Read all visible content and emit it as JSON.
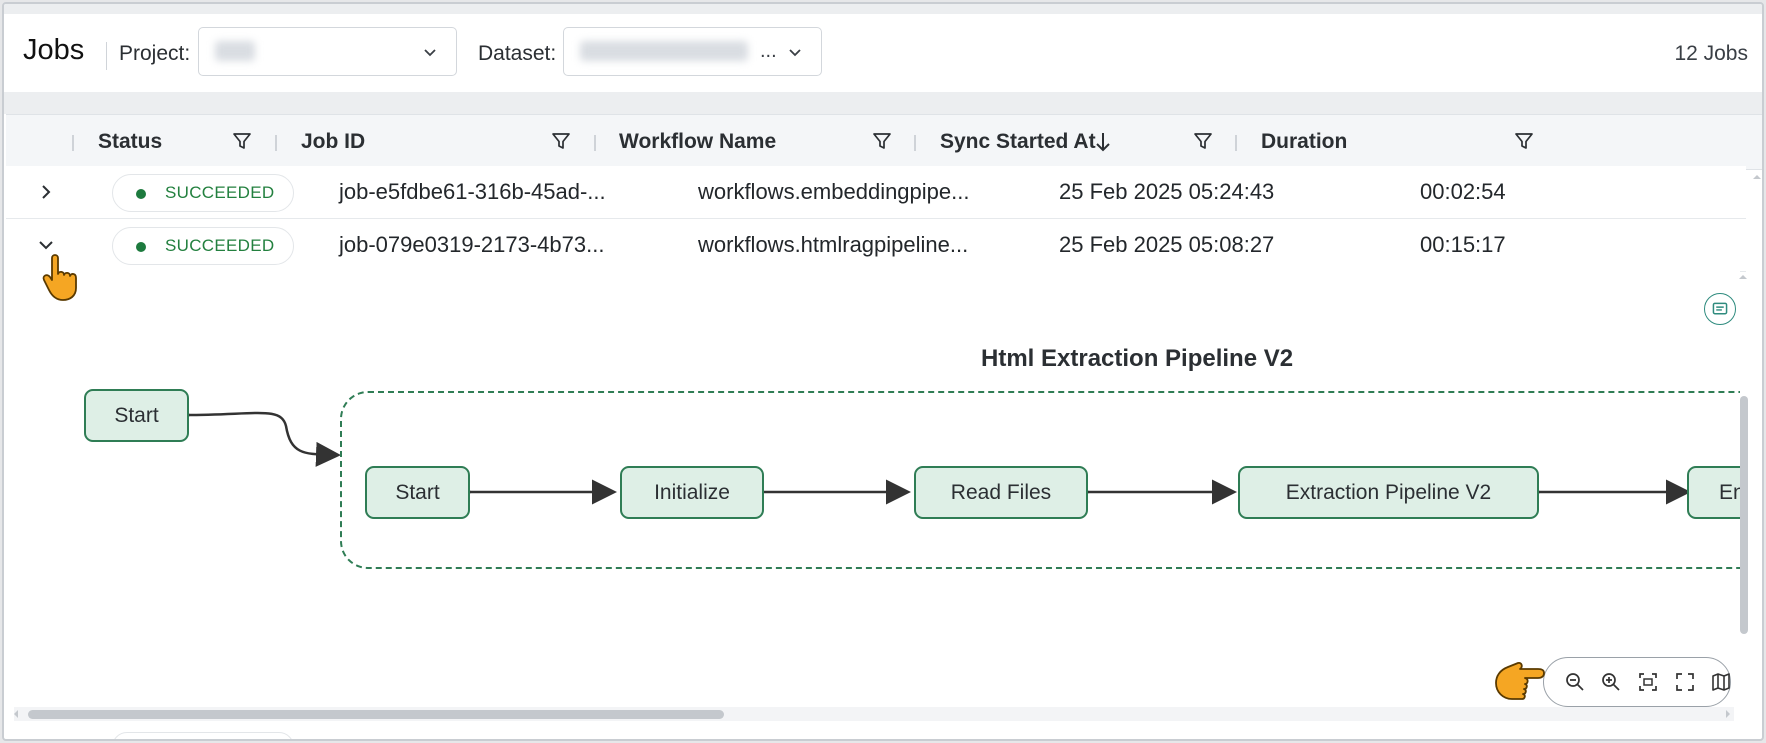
{
  "header": {
    "title": "Jobs",
    "project_label": "Project:",
    "dataset_label": "Dataset:",
    "dataset_value": "...",
    "jobs_count": "12 Jobs"
  },
  "table": {
    "columns": [
      {
        "label": "Status"
      },
      {
        "label": "Job ID"
      },
      {
        "label": "Workflow Name"
      },
      {
        "label": "Sync Started At"
      },
      {
        "label": "Duration"
      }
    ],
    "rows": [
      {
        "status": "SUCCEEDED",
        "job_id": "job-e5fdbe61-316b-45ad-...",
        "workflow": "workflows.embeddingpipe...",
        "started": "25 Feb 2025 05:24:43",
        "duration": "00:02:54",
        "expanded": false
      },
      {
        "status": "SUCCEEDED",
        "job_id": "job-079e0319-2173-4b73...",
        "workflow": "workflows.htmlragpipeline...",
        "started": "25 Feb 2025 05:08:27",
        "duration": "00:15:17",
        "expanded": true
      }
    ]
  },
  "workflow_graph": {
    "title": "Html Extraction Pipeline V2",
    "outer_start": "Start",
    "nodes": [
      "Start",
      "Initialize",
      "Read Files",
      "Extraction Pipeline V2",
      "En"
    ]
  },
  "zoom_controls": [
    "zoom-out-icon",
    "zoom-in-icon",
    "fit-view-icon",
    "fullscreen-icon",
    "minimap-icon"
  ],
  "colors": {
    "success": "#23803f",
    "node_fill": "#deefe6",
    "node_border": "#2f7d55",
    "cursor": "#f5a623"
  }
}
